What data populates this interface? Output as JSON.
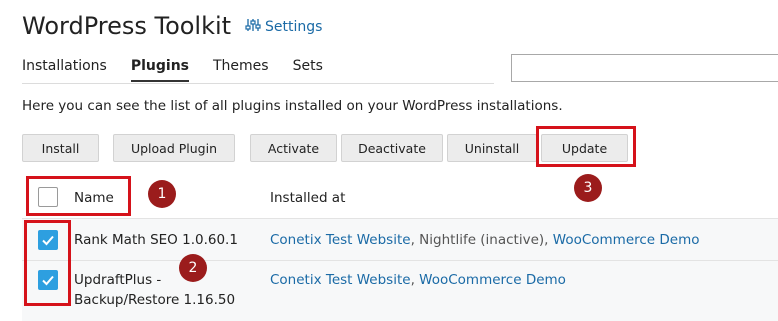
{
  "header": {
    "title": "WordPress Toolkit",
    "settings_label": "Settings"
  },
  "tabs": [
    {
      "label": "Installations",
      "active": false
    },
    {
      "label": "Plugins",
      "active": true
    },
    {
      "label": "Themes",
      "active": false
    },
    {
      "label": "Sets",
      "active": false
    }
  ],
  "search": {
    "value": "",
    "placeholder": ""
  },
  "description": "Here you can see the list of all plugins installed on your WordPress installations.",
  "toolbar": {
    "install": "Install",
    "upload_plugin": "Upload Plugin",
    "activate": "Activate",
    "deactivate": "Deactivate",
    "uninstall": "Uninstall",
    "update": "Update"
  },
  "table": {
    "columns": {
      "name": "Name",
      "installed_at": "Installed at"
    },
    "rows": [
      {
        "checked": true,
        "name": "Rank Math SEO 1.0.60.1",
        "site1": "Conetix Test Website",
        "sep1": ", ",
        "site2": "Nightlife (inactive)",
        "sep2": ", ",
        "site3": "WooCommerce Demo"
      },
      {
        "checked": true,
        "name_line1": "UpdraftPlus -",
        "name_line2": "Backup/Restore 1.16.50",
        "site1": "Conetix Test Website",
        "sep1": ", ",
        "site2": "WooCommerce Demo"
      }
    ]
  },
  "annotations": {
    "marker1": "1",
    "marker2": "2",
    "marker3": "3"
  },
  "colors": {
    "link": "#1a6aa6",
    "checkbox": "#2d9fe0",
    "highlight_box": "#d5121a",
    "marker": "#9b1c1c"
  }
}
